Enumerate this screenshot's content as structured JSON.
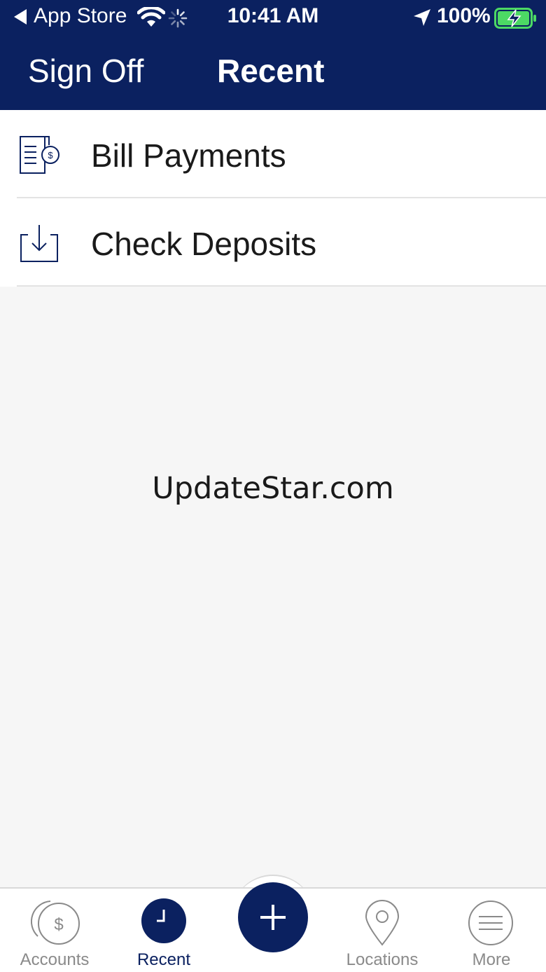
{
  "status_bar": {
    "back_label": "App Store",
    "time": "10:41 AM",
    "battery": "100%"
  },
  "nav": {
    "sign_off": "Sign Off",
    "title": "Recent"
  },
  "list": {
    "items": [
      {
        "label": "Bill Payments",
        "icon": "bill-payment-icon"
      },
      {
        "label": "Check Deposits",
        "icon": "download-tray-icon"
      }
    ]
  },
  "watermark": "UpdateStar.com",
  "tabs": [
    {
      "label": "Accounts",
      "icon": "dollar-coin-icon",
      "active": false
    },
    {
      "label": "Recent",
      "icon": "clock-icon",
      "active": true
    },
    {
      "label": "",
      "icon": "plus-icon",
      "active": false
    },
    {
      "label": "Locations",
      "icon": "location-pin-icon",
      "active": false
    },
    {
      "label": "More",
      "icon": "menu-lines-icon",
      "active": false
    }
  ],
  "colors": {
    "brand_navy": "#0b2160",
    "battery_green": "#4cd964",
    "inactive_tab": "#8a8a8a"
  }
}
